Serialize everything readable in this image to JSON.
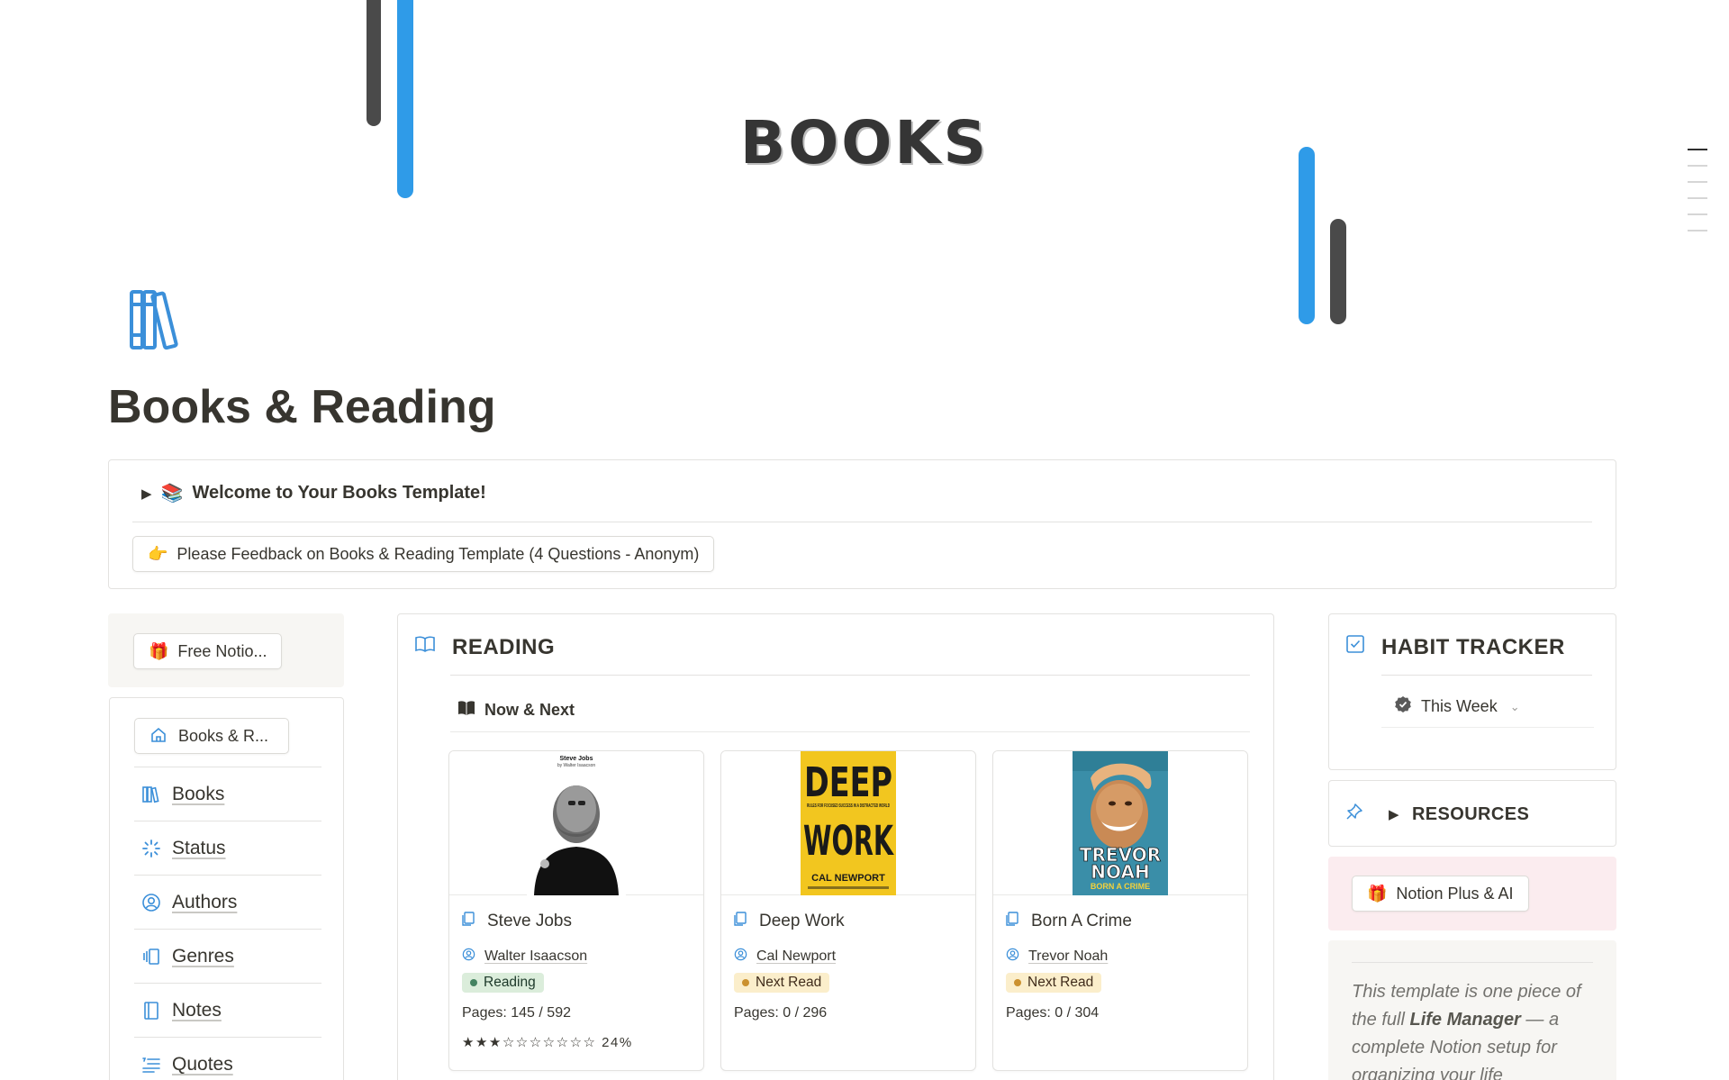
{
  "cover": {
    "title": "BOOKS"
  },
  "page": {
    "title": "Books & Reading",
    "icon": "bookshelf-icon"
  },
  "callout": {
    "toggle_label": "Welcome to Your Books Template!",
    "toggle_emoji": "📚",
    "feedback_label": "Please Feedback on Books & Reading Template (4 Questions - Anonym)",
    "feedback_emoji": "👉"
  },
  "left": {
    "free_button": "Free Notio...",
    "free_emoji": "🎁",
    "home_button": "Books & R...",
    "nav": [
      {
        "label": "Books",
        "icon": "bookshelf-icon"
      },
      {
        "label": "Status",
        "icon": "loading-icon"
      },
      {
        "label": "Authors",
        "icon": "person-circle-icon"
      },
      {
        "label": "Genres",
        "icon": "stack-icon"
      },
      {
        "label": "Notes",
        "icon": "notebook-icon"
      },
      {
        "label": "Quotes",
        "icon": "quote-list-icon"
      }
    ]
  },
  "reading": {
    "title": "READING",
    "view_tab": "Now & Next",
    "cards": [
      {
        "title": "Steve Jobs",
        "author": "Walter Isaacson",
        "status": "Reading",
        "status_color": "green",
        "pages": "Pages: 145 / 592",
        "rating": "★★★☆☆☆☆☆☆☆ 24%",
        "progress": 0.24,
        "cover_top": "Steve Jobs",
        "cover_sub": "by Walter Isaacson"
      },
      {
        "title": "Deep Work",
        "author": "Cal Newport",
        "status": "Next Read",
        "status_color": "yellow",
        "pages": "Pages: 0 / 296",
        "cover_top": "DEEP",
        "cover_mid": "RULES FOR FOCUSED SUCCESS IN A DISTRACTED WORLD",
        "cover_bot": "WORK",
        "cover_author": "CAL NEWPORT"
      },
      {
        "title": "Born A Crime",
        "author": "Trevor Noah",
        "status": "Next Read",
        "status_color": "yellow",
        "pages": "Pages: 0 / 304",
        "cover_top": "TREVOR",
        "cover_bot": "NOAH",
        "cover_sub": "BORN A CRIME"
      }
    ]
  },
  "habit": {
    "title": "HABIT TRACKER",
    "view_tab": "This Week"
  },
  "resources": {
    "title": "RESOURCES"
  },
  "plus": {
    "label": "Notion Plus & AI",
    "emoji": "🎁"
  },
  "quote": {
    "pre": "This template is one piece of the full ",
    "bold": "Life Manager",
    "post": " — a complete Notion setup for organizing your life"
  },
  "colors": {
    "accent_blue": "#2f9be8",
    "bar_dark": "#4a4a4a",
    "icon_blue": "#3b8fd9"
  }
}
